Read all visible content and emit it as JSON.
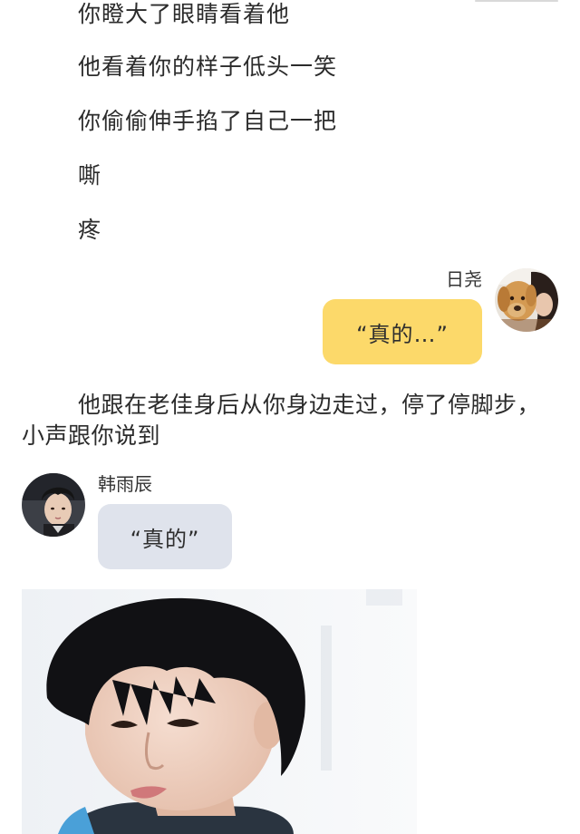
{
  "story_lines": [
    "你瞪大了眼睛看着他",
    "他看着你的样子低头一笑",
    "你偷偷伸手掐了自己一把",
    "嘶",
    "疼"
  ],
  "message_right": {
    "sender": "日尧",
    "text": "“真的…”"
  },
  "paragraph": "他跟在老佳身后从你身边走过，停了停脚步，小声跟你说到",
  "message_left": {
    "sender": "韩雨辰",
    "text": "“真的”"
  },
  "colors": {
    "bubble_right": "#fcd96a",
    "bubble_left": "#dfe3ec",
    "text": "#2b2b2b"
  },
  "icons": {
    "avatar_right": "dog-and-girl-avatar",
    "avatar_left": "boy-portrait-avatar"
  }
}
